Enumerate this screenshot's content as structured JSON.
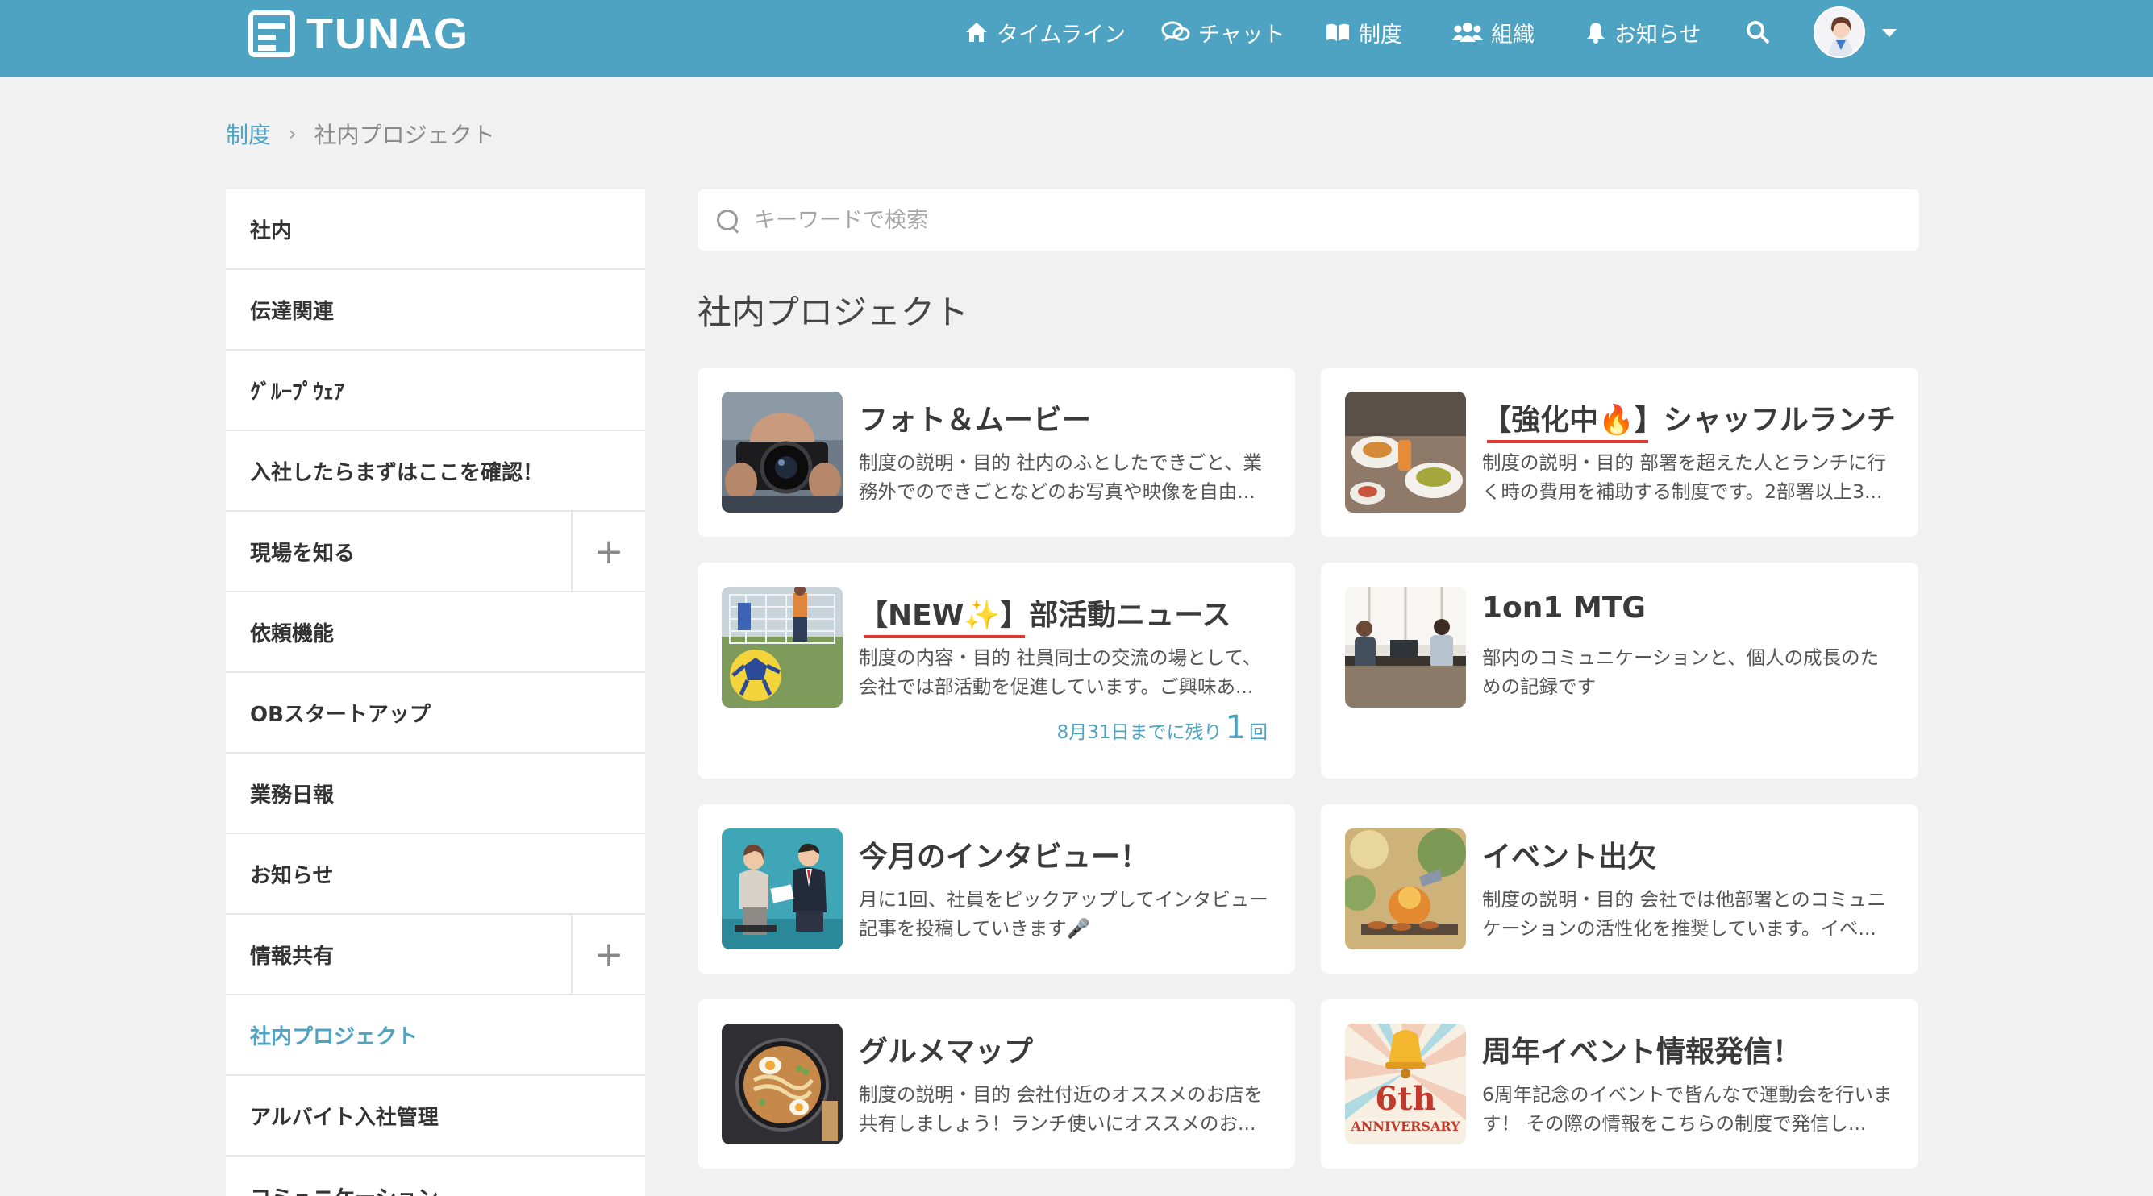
{
  "header": {
    "logo_text": "TUNAG",
    "nav": [
      {
        "label": "タイムライン",
        "icon": "home-icon"
      },
      {
        "label": "チャット",
        "icon": "chat-icon"
      },
      {
        "label": "制度",
        "icon": "book-icon"
      },
      {
        "label": "組織",
        "icon": "people-icon"
      },
      {
        "label": "お知らせ",
        "icon": "bell-icon"
      }
    ],
    "accent_color": "#4da3c1"
  },
  "breadcrumb": {
    "parent": "制度",
    "current": "社内プロジェクト"
  },
  "sidebar": {
    "items": [
      {
        "label": "社内"
      },
      {
        "label": "伝達関連"
      },
      {
        "label": "ｸﾞﾙｰﾌﾟｳｪｱ"
      },
      {
        "label": "入社したらまずはここを確認！"
      },
      {
        "label": "現場を知る",
        "expand": "+"
      },
      {
        "label": "依頼機能"
      },
      {
        "label": "OBスタートアップ"
      },
      {
        "label": "業務日報"
      },
      {
        "label": "お知らせ"
      },
      {
        "label": "情報共有",
        "expand": "+"
      },
      {
        "label": "社内プロジェクト"
      },
      {
        "label": "アルバイト入社管理"
      },
      {
        "label": "コミュニケーション"
      }
    ]
  },
  "search": {
    "placeholder": "キーワードで検索"
  },
  "page_title": "社内プロジェクト",
  "cards": [
    {
      "title": "フォト＆ムービー",
      "desc": "制度の説明・目的 社内のふとしたできごと、業務外でのできごとなどのお写真や映像を自由..."
    },
    {
      "title": "【強化中🔥】シャッフルランチ",
      "desc": "制度の説明・目的 部署を超えた人とランチに行く時の費用を補助する制度です。2部署以上3..."
    },
    {
      "title": "【NEW✨】部活動ニュース",
      "desc": "制度の内容・目的 社員同士の交流の場として、会社では部活動を促進しています。ご興味あ...",
      "remain_prefix": "8月31日までに残り",
      "remain_count": "1",
      "remain_suffix": "回"
    },
    {
      "title": "1on1 MTG",
      "desc": "部内のコミュニケーションと、個人の成長のための記録です"
    },
    {
      "title": "今月のインタビュー！",
      "desc": "月に1回、社員をピックアップしてインタビュー記事を投稿していきます🎤"
    },
    {
      "title": "イベント出欠",
      "desc": "制度の説明・目的 会社では他部署とのコミュニケーションの活性化を推奨しています。イベ..."
    },
    {
      "title": "グルメマップ",
      "desc": "制度の説明・目的 会社付近のオススメのお店を共有しましょう！ランチ使いにオススメのお..."
    },
    {
      "title": "周年イベント情報発信！",
      "desc": "6周年記念のイベントで皆んなで運動会を行います！ その際の情報をこちらの制度で発信し...",
      "thumb_text_1": "6th",
      "thumb_text_2": "ANNIVERSARY"
    }
  ]
}
